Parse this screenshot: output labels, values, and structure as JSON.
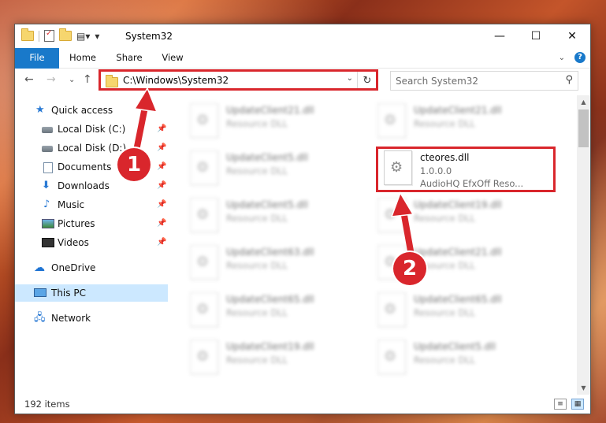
{
  "window": {
    "title": "System32",
    "minimize": "—",
    "maximize": "☐",
    "close": "✕"
  },
  "ribbon": {
    "tabs": [
      "File",
      "Home",
      "Share",
      "View"
    ],
    "collapse": "⌄",
    "help": "?"
  },
  "nav": {
    "back": "←",
    "forward": "→",
    "recent": "⌄",
    "up": "↑"
  },
  "address": {
    "path": "C:\\Windows\\System32",
    "dropdown": "⌄",
    "refresh": "↻"
  },
  "search": {
    "placeholder": "Search System32",
    "icon": "⚲"
  },
  "sidebar": {
    "items": [
      {
        "label": "Quick access",
        "icon": "star-icon"
      },
      {
        "label": "Local Disk (C:)",
        "icon": "drive-icon"
      },
      {
        "label": "Local Disk (D:)",
        "icon": "drive-icon"
      },
      {
        "label": "Documents",
        "icon": "documents-icon"
      },
      {
        "label": "Downloads",
        "icon": "download-icon"
      },
      {
        "label": "Music",
        "icon": "music-icon"
      },
      {
        "label": "Pictures",
        "icon": "pictures-icon"
      },
      {
        "label": "Videos",
        "icon": "videos-icon"
      },
      {
        "label": "OneDrive",
        "icon": "cloud-icon"
      },
      {
        "label": "This PC",
        "icon": "computer-icon"
      },
      {
        "label": "Network",
        "icon": "network-icon"
      }
    ],
    "pin": "📌"
  },
  "files": {
    "left": [
      {
        "name": "UpdateClient21.dll",
        "desc": "Resource DLL"
      },
      {
        "name": "UpdateClient5.dll",
        "desc": "Resource DLL"
      },
      {
        "name": "UpdateClient5.dll",
        "desc": "Resource DLL"
      },
      {
        "name": "UpdateClient63.dll",
        "desc": "Resource DLL"
      },
      {
        "name": "UpdateClient65.dll",
        "desc": "Resource DLL"
      },
      {
        "name": "UpdateClient19.dll",
        "desc": "Resource DLL"
      }
    ],
    "right": [
      {
        "name": "UpdateClient21.dll",
        "desc": "Resource DLL"
      },
      {
        "name": "UpdateClient19.dll",
        "desc": "Resource DLL"
      },
      {
        "name": "UpdateClient21.dll",
        "desc": "Resource DLL"
      },
      {
        "name": "UpdateClient65.dll",
        "desc": "Resource DLL"
      },
      {
        "name": "UpdateClient5.dll",
        "desc": "Resource DLL"
      }
    ],
    "highlighted": {
      "name": "cteores.dll",
      "version": "1.0.0.0",
      "desc": "AudioHQ EfxOff Reso..."
    }
  },
  "status": {
    "count": "192 items",
    "details_view": "≡",
    "icons_view": "▦"
  },
  "annotations": {
    "step1": "1",
    "step2": "2",
    "color": "#d9262c"
  }
}
